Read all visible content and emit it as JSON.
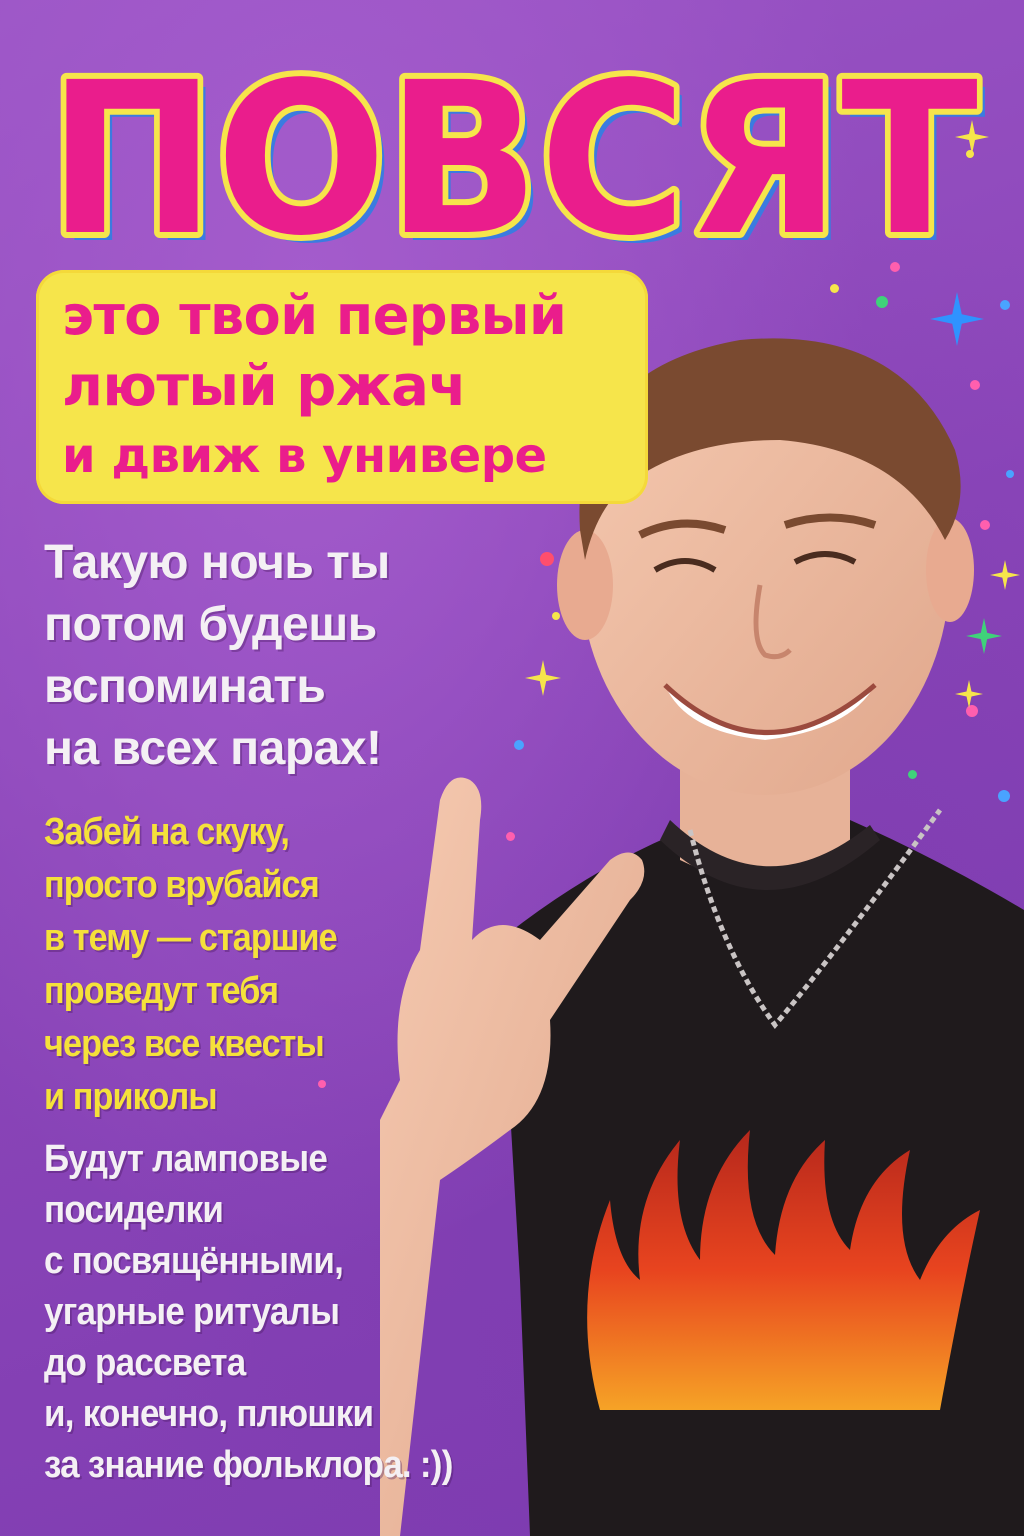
{
  "poster": {
    "title": "ПОВСЯТ",
    "subtitle": {
      "line1": "это твой первый",
      "line2": "лютый ржач",
      "line3": "и движ в универе"
    },
    "intro_lines": [
      "Такую ночь ты",
      "потом будешь",
      "вспоминать",
      "на всех парах!"
    ],
    "middle_lines": [
      "Забей на скуку,",
      "просто врубайся",
      "в тему — старшие",
      "проведут тебя",
      "через все квесты",
      "и приколы"
    ],
    "closing_lines": [
      "Будут ламповые",
      "посиделки",
      "с посвящёнными,",
      "угарные ритуалы",
      "до рассвета",
      "и, конечно, плюшки",
      "за знание фольклора. :))"
    ],
    "colors": {
      "background": "#8a45b8",
      "title_pink": "#ea1d8c",
      "title_outline": "#f6e54b",
      "accent_yellow": "#f5e13a",
      "text_white": "#f4f0f4"
    },
    "photo_description_icon": "photo-of-smiling-student-icon"
  }
}
